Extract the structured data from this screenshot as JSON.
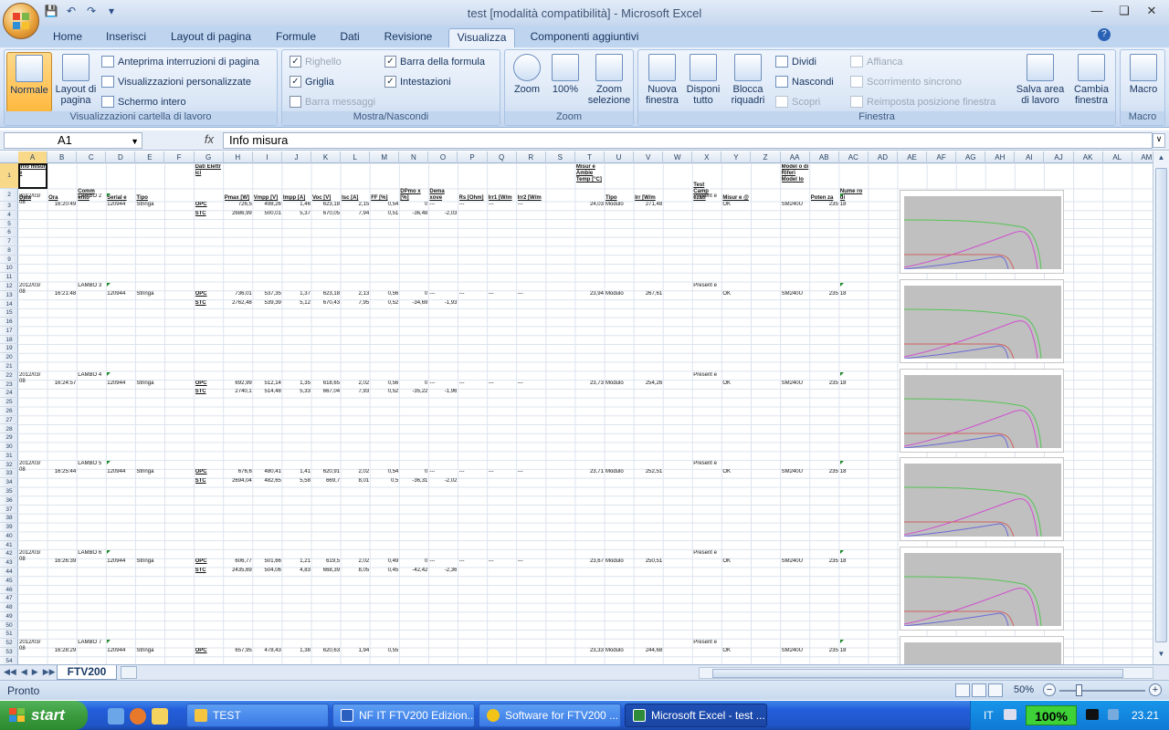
{
  "window": {
    "title": "test  [modalità compatibilità] - Microsoft Excel"
  },
  "ribbon_tabs": [
    "Home",
    "Inserisci",
    "Layout di pagina",
    "Formule",
    "Dati",
    "Revisione",
    "Visualizza",
    "Componenti aggiuntivi"
  ],
  "ribbon": {
    "views_group": {
      "label": "Visualizzazioni cartella di lavoro",
      "normale": "Normale",
      "layout_pagina": "Layout di pagina",
      "anteprima": "Anteprima interruzioni di pagina",
      "personalizzate": "Visualizzazioni personalizzate",
      "schermo_intero": "Schermo intero"
    },
    "show_group": {
      "label": "Mostra/Nascondi",
      "righello": "Righello",
      "griglia": "Griglia",
      "barra_messaggi": "Barra messaggi",
      "barra_formula": "Barra della formula",
      "intestazioni": "Intestazioni"
    },
    "zoom_group": {
      "label": "Zoom",
      "zoom": "Zoom",
      "cento": "100%",
      "zoom_selezione": "Zoom selezione"
    },
    "window_group": {
      "label": "Finestra",
      "nuova": "Nuova finestra",
      "disponi": "Disponi tutto",
      "blocca": "Blocca riquadri",
      "dividi": "Dividi",
      "nascondi": "Nascondi",
      "scopri": "Scopri",
      "affianca": "Affianca",
      "scorrimento": "Scorrimento sincrono",
      "reimposta": "Reimposta posizione finestra",
      "salva_area": "Salva area di lavoro",
      "cambia": "Cambia finestra"
    },
    "macro_group": {
      "label": "Macro",
      "macro": "Macro"
    }
  },
  "formula_bar": {
    "name_box": "A1",
    "fx": "fx",
    "content": "Info misura"
  },
  "columns": [
    "A",
    "B",
    "C",
    "D",
    "E",
    "F",
    "G",
    "H",
    "I",
    "J",
    "K",
    "L",
    "M",
    "N",
    "O",
    "P",
    "Q",
    "R",
    "S",
    "T",
    "U",
    "V",
    "W",
    "X",
    "Y",
    "Z",
    "AA",
    "AB",
    "AC",
    "AD",
    "AE",
    "AF",
    "AG",
    "AH",
    "AI",
    "AJ",
    "AK",
    "AL",
    "AM"
  ],
  "header_row": {
    "r1": {
      "A": "Info misur e",
      "G": "Dati Elettr ici",
      "T": "Misur e Ambie Temp [°C]",
      "AA": "Model o di Riferi Model lo"
    },
    "r2": {
      "A": "Data",
      "B": "Ora",
      "C": "Comm ento",
      "D": "Serial e",
      "E": "Tipo",
      "H": "Pmax [W]",
      "I": "Vmpp [V]",
      "J": "Impp [A]",
      "K": "Voc [V]",
      "L": "Isc [A]",
      "M": "FF [%]",
      "N": "DPmo x [%]",
      "O": "Dema xove",
      "P": "Rs [Ohm]",
      "Q": "Irr1 [W/m",
      "R": "Irr2 [W/m",
      "U": "Tipo",
      "V": "Irr [W/m",
      "X": "Test Camp ezati",
      "Y": "Misur e @",
      "AB": "Poten za",
      "AC": "Nume ro di"
    }
  },
  "measurements": [
    {
      "date": "2012/03/ 08",
      "time": "16:20:49",
      "comment": "LAMBO 2",
      "serial": "120944",
      "type": "Stringa",
      "opc": {
        "label": "OPC",
        "pmax": "726,5",
        "vmpp": "498,26",
        "impp": "1,46",
        "voc": "623,18",
        "isc": "2,15",
        "ff": "0,54",
        "dp": "0",
        "dm": "---"
      },
      "stc": {
        "label": "STC",
        "pmax": "2686,99",
        "vmpp": "500,01",
        "impp": "5,37",
        "voc": "670,05",
        "isc": "7,94",
        "ff": "0,51",
        "dp": "-36,48",
        "dm": "-2,03"
      },
      "rs": "---",
      "irr1": "---",
      "irr2": "---",
      "temp": "24,03",
      "tipo": "Modulo",
      "irr": "271,48",
      "test": "Present e",
      "mis": "OK",
      "model": "SM240U",
      "pot": "235",
      "num": "18"
    },
    {
      "date": "2012/03/ 08",
      "time": "16:21:48",
      "comment": "LAMBO 3",
      "serial": "120944",
      "type": "Stringa",
      "opc": {
        "label": "OPC",
        "pmax": "736,01",
        "vmpp": "537,35",
        "impp": "1,37",
        "voc": "623,18",
        "isc": "2,13",
        "ff": "0,56",
        "dp": "0",
        "dm": "---"
      },
      "stc": {
        "label": "STC",
        "pmax": "2762,48",
        "vmpp": "539,39",
        "impp": "5,12",
        "voc": "670,43",
        "isc": "7,95",
        "ff": "0,52",
        "dp": "-34,69",
        "dm": "-1,93"
      },
      "rs": "---",
      "irr1": "---",
      "irr2": "---",
      "temp": "23,94",
      "tipo": "Modulo",
      "irr": "267,61",
      "test": "Present e",
      "mis": "OK",
      "model": "SM240U",
      "pot": "235",
      "num": "18"
    },
    {
      "date": "2012/03/ 08",
      "time": "16:24:57",
      "comment": "LAMBO 4",
      "serial": "120944",
      "type": "Stringa",
      "opc": {
        "label": "OPC",
        "pmax": "692,99",
        "vmpp": "512,14",
        "impp": "1,35",
        "voc": "618,65",
        "isc": "2,02",
        "ff": "0,56",
        "dp": "0",
        "dm": "---"
      },
      "stc": {
        "label": "STC",
        "pmax": "2740,1",
        "vmpp": "514,48",
        "impp": "5,33",
        "voc": "667,04",
        "isc": "7,93",
        "ff": "0,52",
        "dp": "-35,22",
        "dm": "-1,96"
      },
      "rs": "---",
      "irr1": "---",
      "irr2": "---",
      "temp": "23,73",
      "tipo": "Modulo",
      "irr": "254,26",
      "test": "Present e",
      "mis": "OK",
      "model": "SM240U",
      "pot": "235",
      "num": "18"
    },
    {
      "date": "2012/03/ 08",
      "time": "16:25:44",
      "comment": "LAMBO 5",
      "serial": "120944",
      "type": "Stringa",
      "opc": {
        "label": "OPC",
        "pmax": "676,6",
        "vmpp": "480,41",
        "impp": "1,41",
        "voc": "620,91",
        "isc": "2,02",
        "ff": "0,54",
        "dp": "0",
        "dm": "---"
      },
      "stc": {
        "label": "STC",
        "pmax": "2694,04",
        "vmpp": "482,65",
        "impp": "5,58",
        "voc": "669,7",
        "isc": "8,01",
        "ff": "0,5",
        "dp": "-36,31",
        "dm": "-2,02"
      },
      "rs": "---",
      "irr1": "---",
      "irr2": "---",
      "temp": "23,71",
      "tipo": "Modulo",
      "irr": "252,51",
      "test": "Present e",
      "mis": "OK",
      "model": "SM240U",
      "pot": "235",
      "num": "18"
    },
    {
      "date": "2012/03/ 08",
      "time": "16:26:39",
      "comment": "LAMBO 6",
      "serial": "120944",
      "type": "Stringa",
      "opc": {
        "label": "OPC",
        "pmax": "606,77",
        "vmpp": "501,66",
        "impp": "1,21",
        "voc": "619,5",
        "isc": "2,02",
        "ff": "0,49",
        "dp": "0",
        "dm": "---"
      },
      "stc": {
        "label": "STC",
        "pmax": "2435,69",
        "vmpp": "504,06",
        "impp": "4,83",
        "voc": "668,39",
        "isc": "8,05",
        "ff": "0,45",
        "dp": "-42,42",
        "dm": "-2,36"
      },
      "rs": "---",
      "irr1": "---",
      "irr2": "---",
      "temp": "23,67",
      "tipo": "Modulo",
      "irr": "250,51",
      "test": "Present e",
      "mis": "OK",
      "model": "SM240U",
      "pot": "235",
      "num": "18"
    },
    {
      "date": "2012/03/ 08",
      "time": "16:28:29",
      "comment": "LAMBO 7",
      "serial": "120944",
      "type": "Stringa",
      "opc": {
        "label": "OPC",
        "pmax": "657,95",
        "vmpp": "478,43",
        "impp": "1,38",
        "voc": "620,63",
        "isc": "1,94",
        "ff": "0,55",
        "dp": "",
        "dm": ""
      },
      "stc": {
        "label": "",
        "pmax": "",
        "vmpp": "",
        "impp": "",
        "voc": "",
        "isc": "",
        "ff": "",
        "dp": "",
        "dm": ""
      },
      "rs": "",
      "irr1": "",
      "irr2": "",
      "temp": "23,33",
      "tipo": "Modulo",
      "irr": "244,68",
      "test": "Present e",
      "mis": "OK",
      "model": "SM240U",
      "pot": "235",
      "num": "18"
    }
  ],
  "sheet_tab": "FTV200",
  "status": {
    "text": "Pronto",
    "zoom": "50%"
  },
  "taskbar": {
    "start": "start",
    "tasks": [
      "TEST",
      "NF IT FTV200 Edizion...",
      "Software for FTV200 ...",
      "Microsoft Excel - test ..."
    ],
    "lang": "IT",
    "battery": "100%",
    "clock": "23.21"
  },
  "colors": {
    "ribbon_bg": "#d5e3f5",
    "selected_header": "#f8d98a",
    "taskbar": "#245edb",
    "start_green": "#3a9b3e"
  }
}
